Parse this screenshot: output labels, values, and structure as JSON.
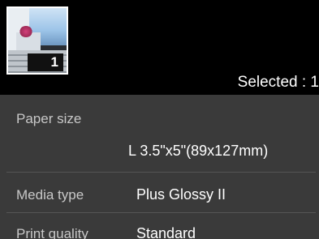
{
  "photo": {
    "index_badge": "1"
  },
  "status": {
    "selected": "Selected : 1"
  },
  "settings": [
    {
      "label": "Paper size",
      "value": "L 3.5\"x5\"(89x127mm)"
    },
    {
      "label": "Media type",
      "value": "Plus Glossy II"
    },
    {
      "label": "Print quality",
      "value": "Standard"
    }
  ]
}
